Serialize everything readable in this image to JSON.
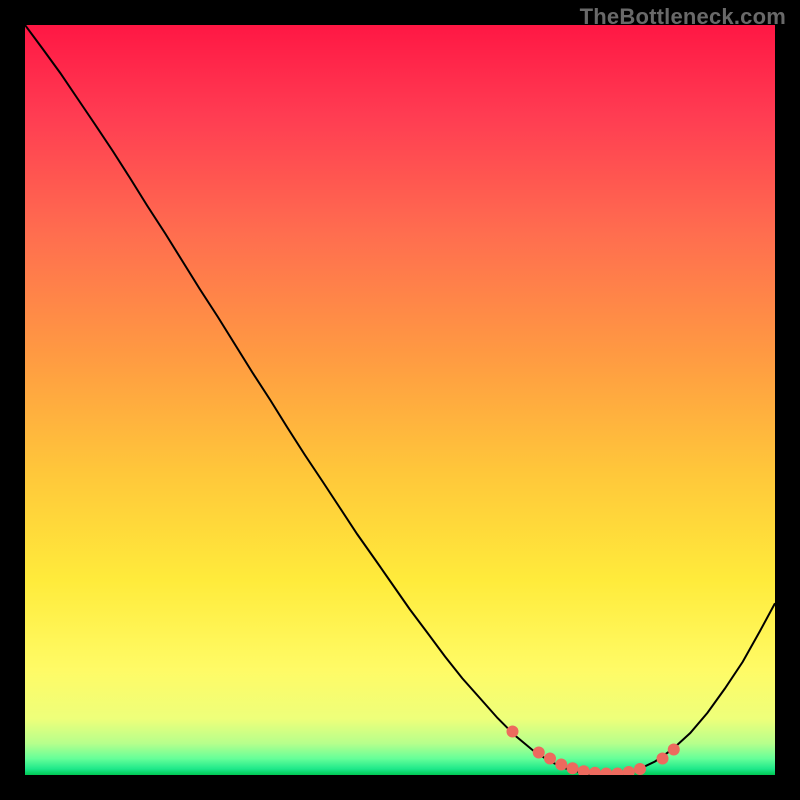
{
  "watermark": "TheBottleneck.com",
  "chart_data": {
    "type": "line",
    "title": "",
    "xlabel": "",
    "ylabel": "",
    "xlim": [
      0,
      100
    ],
    "ylim": [
      0,
      100
    ],
    "grid": false,
    "legend": false,
    "series": [
      {
        "name": "curve",
        "stroke": "#000000",
        "stroke_width": 2,
        "x": [
          0.0,
          2.3,
          4.7,
          7.0,
          9.3,
          11.7,
          14.0,
          16.3,
          18.7,
          21.0,
          23.3,
          25.7,
          28.0,
          30.3,
          32.7,
          35.0,
          37.3,
          39.7,
          42.0,
          44.3,
          46.7,
          49.0,
          51.3,
          53.7,
          56.0,
          58.3,
          60.7,
          63.0,
          65.3,
          67.7,
          70.0,
          72.3,
          74.7,
          77.0,
          79.3,
          81.7,
          84.0,
          86.3,
          88.7,
          91.0,
          93.3,
          95.7,
          98.0,
          100.0
        ],
        "y": [
          100.0,
          96.9,
          93.6,
          90.2,
          86.8,
          83.2,
          79.6,
          75.9,
          72.2,
          68.5,
          64.8,
          61.1,
          57.4,
          53.7,
          50.0,
          46.3,
          42.7,
          39.1,
          35.6,
          32.1,
          28.7,
          25.4,
          22.1,
          18.9,
          15.8,
          12.9,
          10.2,
          7.6,
          5.3,
          3.3,
          1.8,
          0.8,
          0.2,
          0.0,
          0.1,
          0.7,
          1.8,
          3.4,
          5.6,
          8.3,
          11.5,
          15.1,
          19.2,
          22.9
        ]
      },
      {
        "name": "good-range-markers",
        "type": "scatter",
        "marker": "circle",
        "color": "#ED6A5E",
        "radius": 6,
        "x": [
          65.0,
          68.5,
          70.0,
          71.5,
          73.0,
          74.5,
          76.0,
          77.5,
          79.0,
          80.5,
          82.0,
          85.0,
          86.5
        ],
        "y": [
          5.8,
          3.0,
          2.2,
          1.4,
          0.9,
          0.5,
          0.3,
          0.2,
          0.2,
          0.4,
          0.8,
          2.2,
          3.4
        ]
      }
    ],
    "background_gradient_stops": [
      {
        "offset": 0.0,
        "color": "#FF1744"
      },
      {
        "offset": 0.12,
        "color": "#FF3C52"
      },
      {
        "offset": 0.28,
        "color": "#FF6E4F"
      },
      {
        "offset": 0.44,
        "color": "#FF9A42"
      },
      {
        "offset": 0.6,
        "color": "#FFC83A"
      },
      {
        "offset": 0.74,
        "color": "#FFEB3B"
      },
      {
        "offset": 0.86,
        "color": "#FFFB66"
      },
      {
        "offset": 0.925,
        "color": "#EEFF7A"
      },
      {
        "offset": 0.958,
        "color": "#B6FF8C"
      },
      {
        "offset": 0.978,
        "color": "#66FF99"
      },
      {
        "offset": 0.992,
        "color": "#1EE88A"
      },
      {
        "offset": 1.0,
        "color": "#00C853"
      }
    ]
  }
}
